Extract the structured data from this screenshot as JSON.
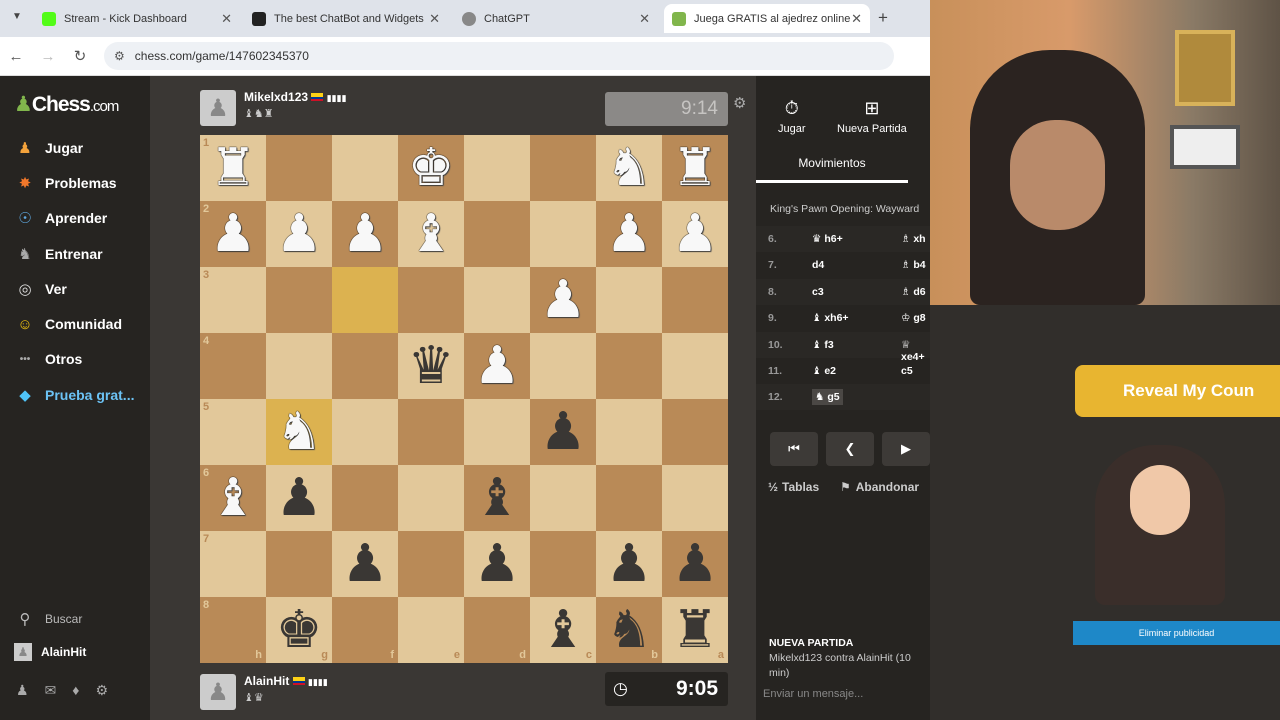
{
  "browser": {
    "tabs": [
      {
        "title": "Stream - Kick Dashboard",
        "color": "#53fc18"
      },
      {
        "title": "The best ChatBot and Widgets",
        "color": "#222222"
      },
      {
        "title": "ChatGPT",
        "color": "#888888"
      },
      {
        "title": "Juega GRATIS al ajedrez online",
        "color": "#81b64c"
      }
    ],
    "url": "chess.com/game/147602345370"
  },
  "sidebar": {
    "logo_a": "♟",
    "logo_b": "Chess",
    "logo_c": ".com",
    "items": [
      {
        "label": "Jugar",
        "icon": "♟"
      },
      {
        "label": "Problemas",
        "icon": "✸"
      },
      {
        "label": "Aprender",
        "icon": "☉"
      },
      {
        "label": "Entrenar",
        "icon": "♞"
      },
      {
        "label": "Ver",
        "icon": "◎"
      },
      {
        "label": "Comunidad",
        "icon": "☺"
      },
      {
        "label": "Otros",
        "icon": "•••"
      },
      {
        "label": "Prueba grat...",
        "icon": "◆"
      }
    ],
    "search": "Buscar",
    "user": "AlainHit"
  },
  "top_player": {
    "name": "Mikelxd123",
    "clock": "9:14"
  },
  "bottom_player": {
    "name": "AlainHit",
    "clock": "9:05"
  },
  "board": {
    "ranks": [
      "1",
      "2",
      "3",
      "4",
      "5",
      "6",
      "7",
      "8"
    ],
    "files": [
      "h",
      "g",
      "f",
      "e",
      "d",
      "c",
      "b",
      "a"
    ],
    "pieces": [
      [
        "wr",
        null,
        null,
        "wk",
        null,
        null,
        "wn",
        "wr"
      ],
      [
        "wp",
        "wp",
        "wp",
        "wb",
        null,
        null,
        "wp",
        "wp"
      ],
      [
        null,
        null,
        null,
        null,
        null,
        "wp",
        null,
        null
      ],
      [
        null,
        null,
        null,
        "bq",
        "wp",
        null,
        null,
        null
      ],
      [
        null,
        "wn",
        null,
        null,
        null,
        "bp",
        null,
        null
      ],
      [
        "wb",
        "bp",
        null,
        null,
        "bb",
        null,
        null,
        null
      ],
      [
        null,
        null,
        "bp",
        null,
        "bp",
        null,
        "bp",
        "bp"
      ],
      [
        null,
        "bk",
        null,
        null,
        null,
        "bb",
        "bn",
        "br"
      ]
    ],
    "highlight": [
      [
        2,
        2
      ],
      [
        4,
        1
      ]
    ]
  },
  "panel": {
    "play": "Jugar",
    "new_game": "Nueva Partida",
    "moves_tab": "Movimientos",
    "opening": "King's Pawn Opening: Wayward",
    "moves": [
      {
        "n": "6.",
        "w": "♛ h6+",
        "b": "♗ xh"
      },
      {
        "n": "7.",
        "w": "d4",
        "b": "♗ b4"
      },
      {
        "n": "8.",
        "w": "c3",
        "b": "♗ d6"
      },
      {
        "n": "9.",
        "w": "♝ xh6+",
        "b": "♔ g8"
      },
      {
        "n": "10.",
        "w": "♝ f3",
        "b": "♕ xe4+"
      },
      {
        "n": "11.",
        "w": "♝ e2",
        "b": "c5"
      },
      {
        "n": "12.",
        "w": "♞ g5",
        "b": ""
      }
    ],
    "draw": "Tablas",
    "resign": "Abandonar",
    "info_title": "NUEVA PARTIDA",
    "info_text": "Mikelxd123 contra AlainHit (10 min)",
    "chat_placeholder": "Enviar un mensaje..."
  },
  "ad": {
    "button": "Reveal My Coun",
    "remove": "Eliminar publicidad"
  }
}
